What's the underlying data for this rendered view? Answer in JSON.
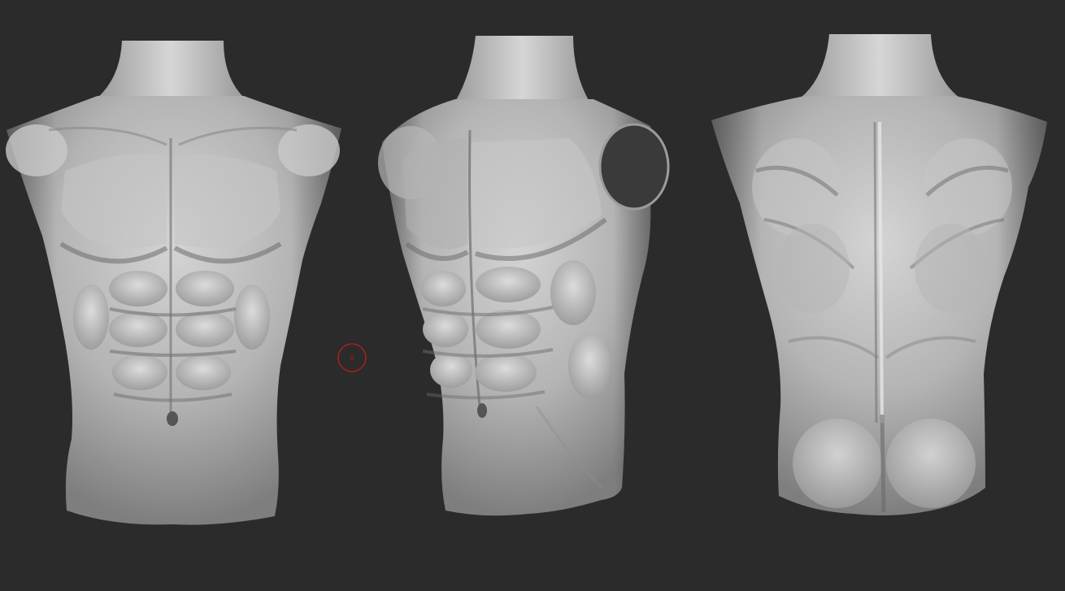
{
  "viewport": {
    "background_color": "#2b2b2b",
    "model_base_color": "#a9a9a9",
    "model_highlight_color": "#dedede",
    "model_shadow_color": "#5a5a5a",
    "brush_cursor_color": "#b01e1e"
  },
  "models": [
    {
      "view": "front",
      "name": "torso-front"
    },
    {
      "view": "three-quarter",
      "name": "torso-three-quarter"
    },
    {
      "view": "back",
      "name": "torso-back"
    }
  ],
  "cursor": {
    "icon": "brush-circle-cursor-icon"
  }
}
